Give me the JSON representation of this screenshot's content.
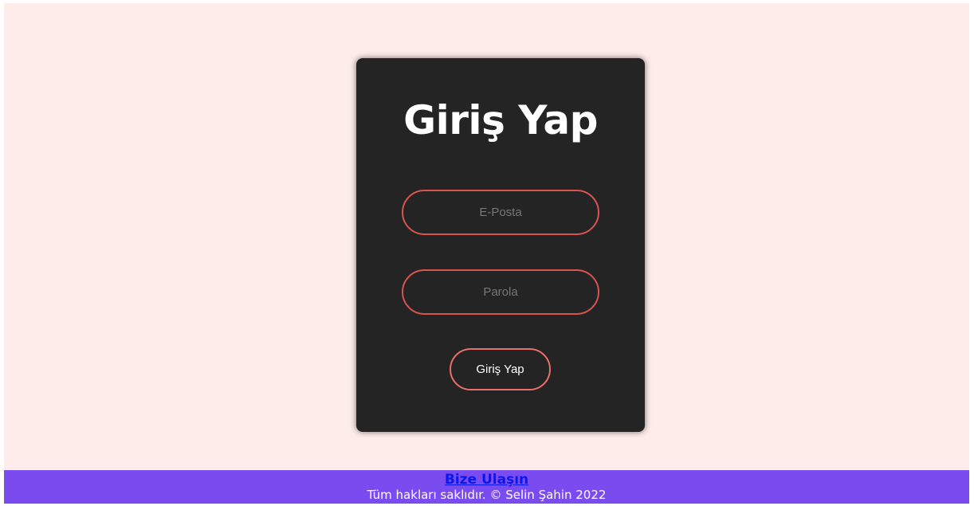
{
  "login": {
    "title": "Giriş Yap",
    "email_placeholder": "E-Posta",
    "password_placeholder": "Parola",
    "submit_label": "Giriş Yap"
  },
  "footer": {
    "contact_link": "Bize Ulaşın",
    "copyright": "Tüm hakları saklıdır. © Selin Şahin 2022"
  },
  "colors": {
    "page_background": "#fdecea",
    "card_background": "#242424",
    "field_border": "#d9534f",
    "footer_background": "#7a4cf0",
    "link": "#0a17ee"
  }
}
